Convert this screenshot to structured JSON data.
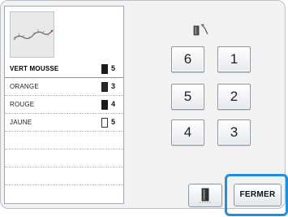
{
  "colors": [
    {
      "label": "VERT MOUSSE",
      "count": "5",
      "spool": "filled"
    },
    {
      "label": "ORANGE",
      "count": "3",
      "spool": "filled"
    },
    {
      "label": "ROUGE",
      "count": "4",
      "spool": "filled"
    },
    {
      "label": "JAUNE",
      "count": "5",
      "spool": "empty"
    }
  ],
  "sequence_buttons": [
    "6",
    "1",
    "5",
    "2",
    "4",
    "3"
  ],
  "icons": {
    "sequence": "thread-sequence-icon",
    "spool_button": "thread-spool-icon",
    "preview": "embroidery-preview"
  },
  "close_button_label": "FERMER",
  "accent_color": "#1e8fd8"
}
